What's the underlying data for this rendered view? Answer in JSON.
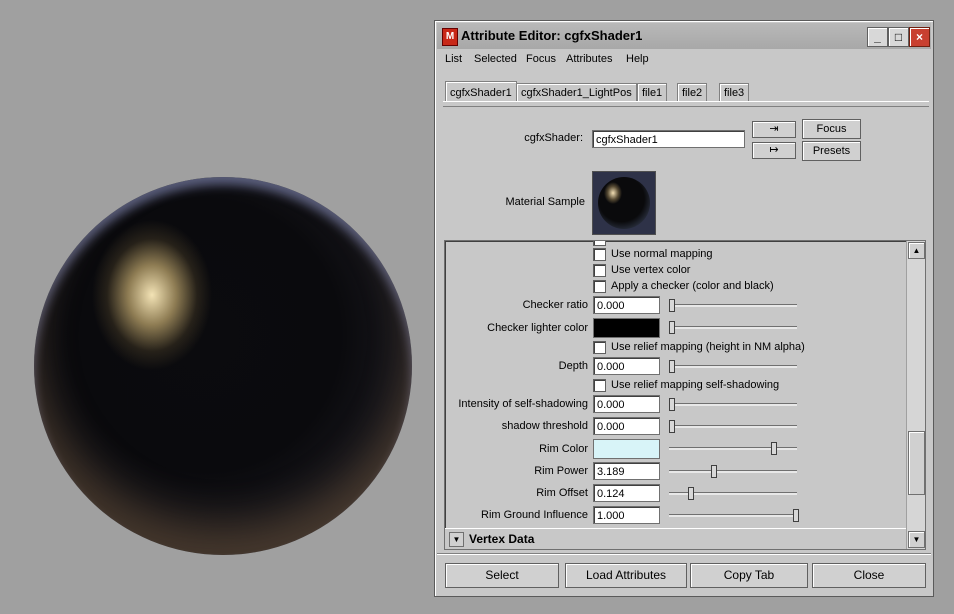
{
  "window": {
    "title": "Attribute Editor: cgfxShader1"
  },
  "menu": [
    "List",
    "Selected",
    "Focus",
    "Attributes",
    "Help"
  ],
  "tabs": [
    "cgfxShader1",
    "cgfxShader1_LightPos",
    "file1",
    "file2",
    "file3"
  ],
  "header": {
    "node_type_label": "cgfxShader:",
    "node_name": "cgfxShader1",
    "focus_label": "Focus",
    "presets_label": "Presets",
    "material_sample_label": "Material Sample"
  },
  "attributes": {
    "use_normal_mapping": "Use normal mapping",
    "use_vertex_color": "Use vertex color",
    "apply_checker": "Apply a checker (color and black)",
    "checker_ratio_label": "Checker ratio",
    "checker_ratio_value": "0.000",
    "checker_lighter_color_label": "Checker lighter color",
    "use_relief_mapping": "Use relief mapping (height in NM alpha)",
    "depth_label": "Depth",
    "depth_value": "0.000",
    "use_relief_self_shadowing": "Use relief mapping self-shadowing",
    "intensity_self_shadowing_label": "Intensity of self-shadowing",
    "intensity_self_shadowing_value": "0.000",
    "shadow_threshold_label": "shadow threshold",
    "shadow_threshold_value": "0.000",
    "rim_color_label": "Rim Color",
    "rim_power_label": "Rim Power",
    "rim_power_value": "3.189",
    "rim_offset_label": "Rim Offset",
    "rim_offset_value": "0.124",
    "rim_ground_influence_label": "Rim Ground Influence",
    "rim_ground_influence_value": "1.000"
  },
  "colors": {
    "checker_lighter_color": "#000000",
    "rim_color": "#d8f4f8"
  },
  "slider_levels": {
    "checker_ratio": 0.0,
    "checker_lighter_color": 0.0,
    "depth": 0.0,
    "intensity_self_shadowing": 0.0,
    "shadow_threshold": 0.0,
    "rim_color": 0.82,
    "rim_power": 0.34,
    "rim_offset": 0.15,
    "rim_ground_influence": 1.0
  },
  "section": {
    "vertex_data_label": "Vertex Data"
  },
  "bottom_buttons": {
    "select": "Select",
    "load_attributes": "Load Attributes",
    "copy_tab": "Copy Tab",
    "close": "Close"
  }
}
